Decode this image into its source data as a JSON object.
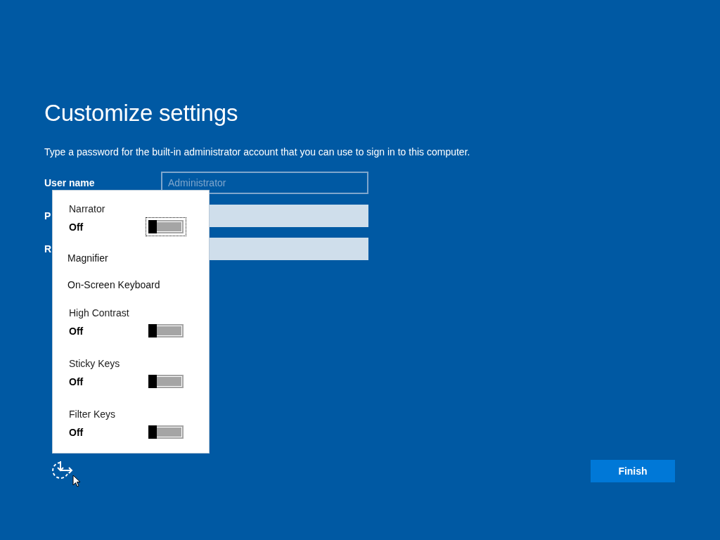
{
  "title": "Customize settings",
  "description": "Type a password for the built-in administrator account that you can use to sign in to this computer.",
  "fields": [
    {
      "label": "User name",
      "placeholder": "Administrator",
      "disabled": true
    },
    {
      "label": "P",
      "disabled": false
    },
    {
      "label": "R",
      "disabled": false
    }
  ],
  "ease_of_access_menu": {
    "items": [
      {
        "kind": "toggle",
        "label": "Narrator",
        "state": "Off",
        "on": false,
        "focused": true
      },
      {
        "kind": "link",
        "label": "Magnifier"
      },
      {
        "kind": "link",
        "label": "On-Screen Keyboard"
      },
      {
        "kind": "toggle",
        "label": "High Contrast",
        "state": "Off",
        "on": false,
        "focused": false
      },
      {
        "kind": "toggle",
        "label": "Sticky Keys",
        "state": "Off",
        "on": false,
        "focused": false
      },
      {
        "kind": "toggle",
        "label": "Filter Keys",
        "state": "Off",
        "on": false,
        "focused": false
      }
    ]
  },
  "finish_button": "Finish"
}
